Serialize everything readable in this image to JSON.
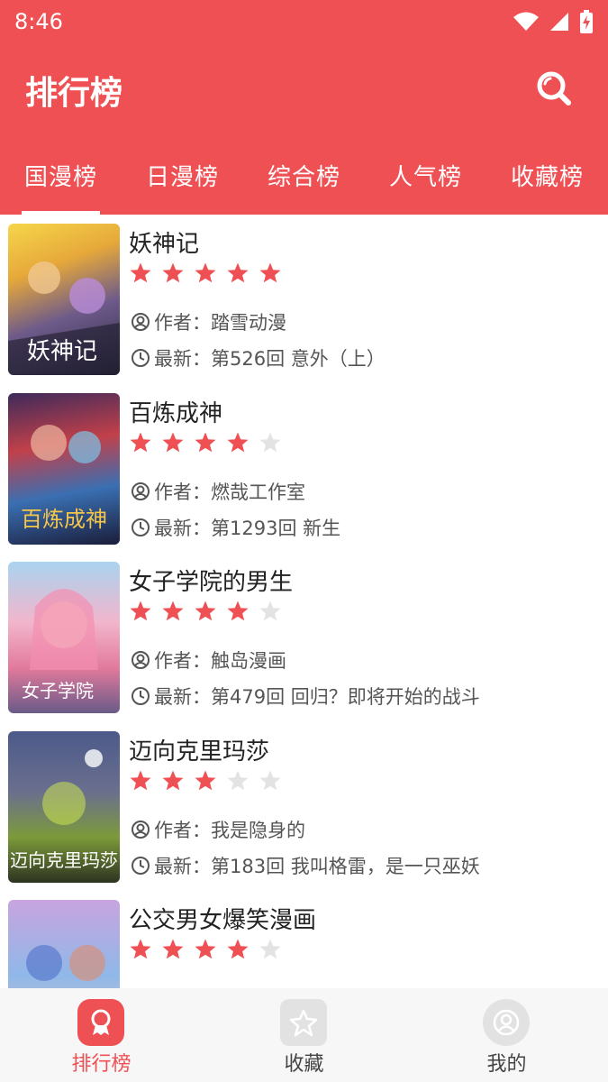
{
  "status": {
    "time": "8:46"
  },
  "header": {
    "title": "排行榜"
  },
  "tabs": [
    {
      "label": "国漫榜",
      "active": true
    },
    {
      "label": "日漫榜",
      "active": false
    },
    {
      "label": "综合榜",
      "active": false
    },
    {
      "label": "人气榜",
      "active": false
    },
    {
      "label": "收藏榜",
      "active": false
    }
  ],
  "author_prefix": "作者：",
  "latest_prefix": "最新：",
  "items": [
    {
      "title": "妖神记",
      "rating": 5,
      "author": "踏雪动漫",
      "latest": "第526回 意外（上）"
    },
    {
      "title": "百炼成神",
      "rating": 4,
      "author": "燃哉工作室",
      "latest": "第1293回 新生"
    },
    {
      "title": "女子学院的男生",
      "rating": 4,
      "author": "触岛漫画",
      "latest": "第479回 回归？即将开始的战斗"
    },
    {
      "title": "迈向克里玛莎",
      "rating": 3,
      "author": "我是隐身的",
      "latest": "第183回 我叫格雷，是一只巫妖"
    },
    {
      "title": "公交男女爆笑漫画",
      "rating": 4,
      "author": "",
      "latest": ""
    }
  ],
  "bottom_nav": [
    {
      "label": "排行榜",
      "icon": "ranking-icon",
      "active": true
    },
    {
      "label": "收藏",
      "icon": "star-icon",
      "active": false
    },
    {
      "label": "我的",
      "icon": "profile-icon",
      "active": false
    }
  ],
  "colors": {
    "accent": "#ef5054",
    "star_on": "#ef5054",
    "star_off": "#e3e3e3"
  }
}
